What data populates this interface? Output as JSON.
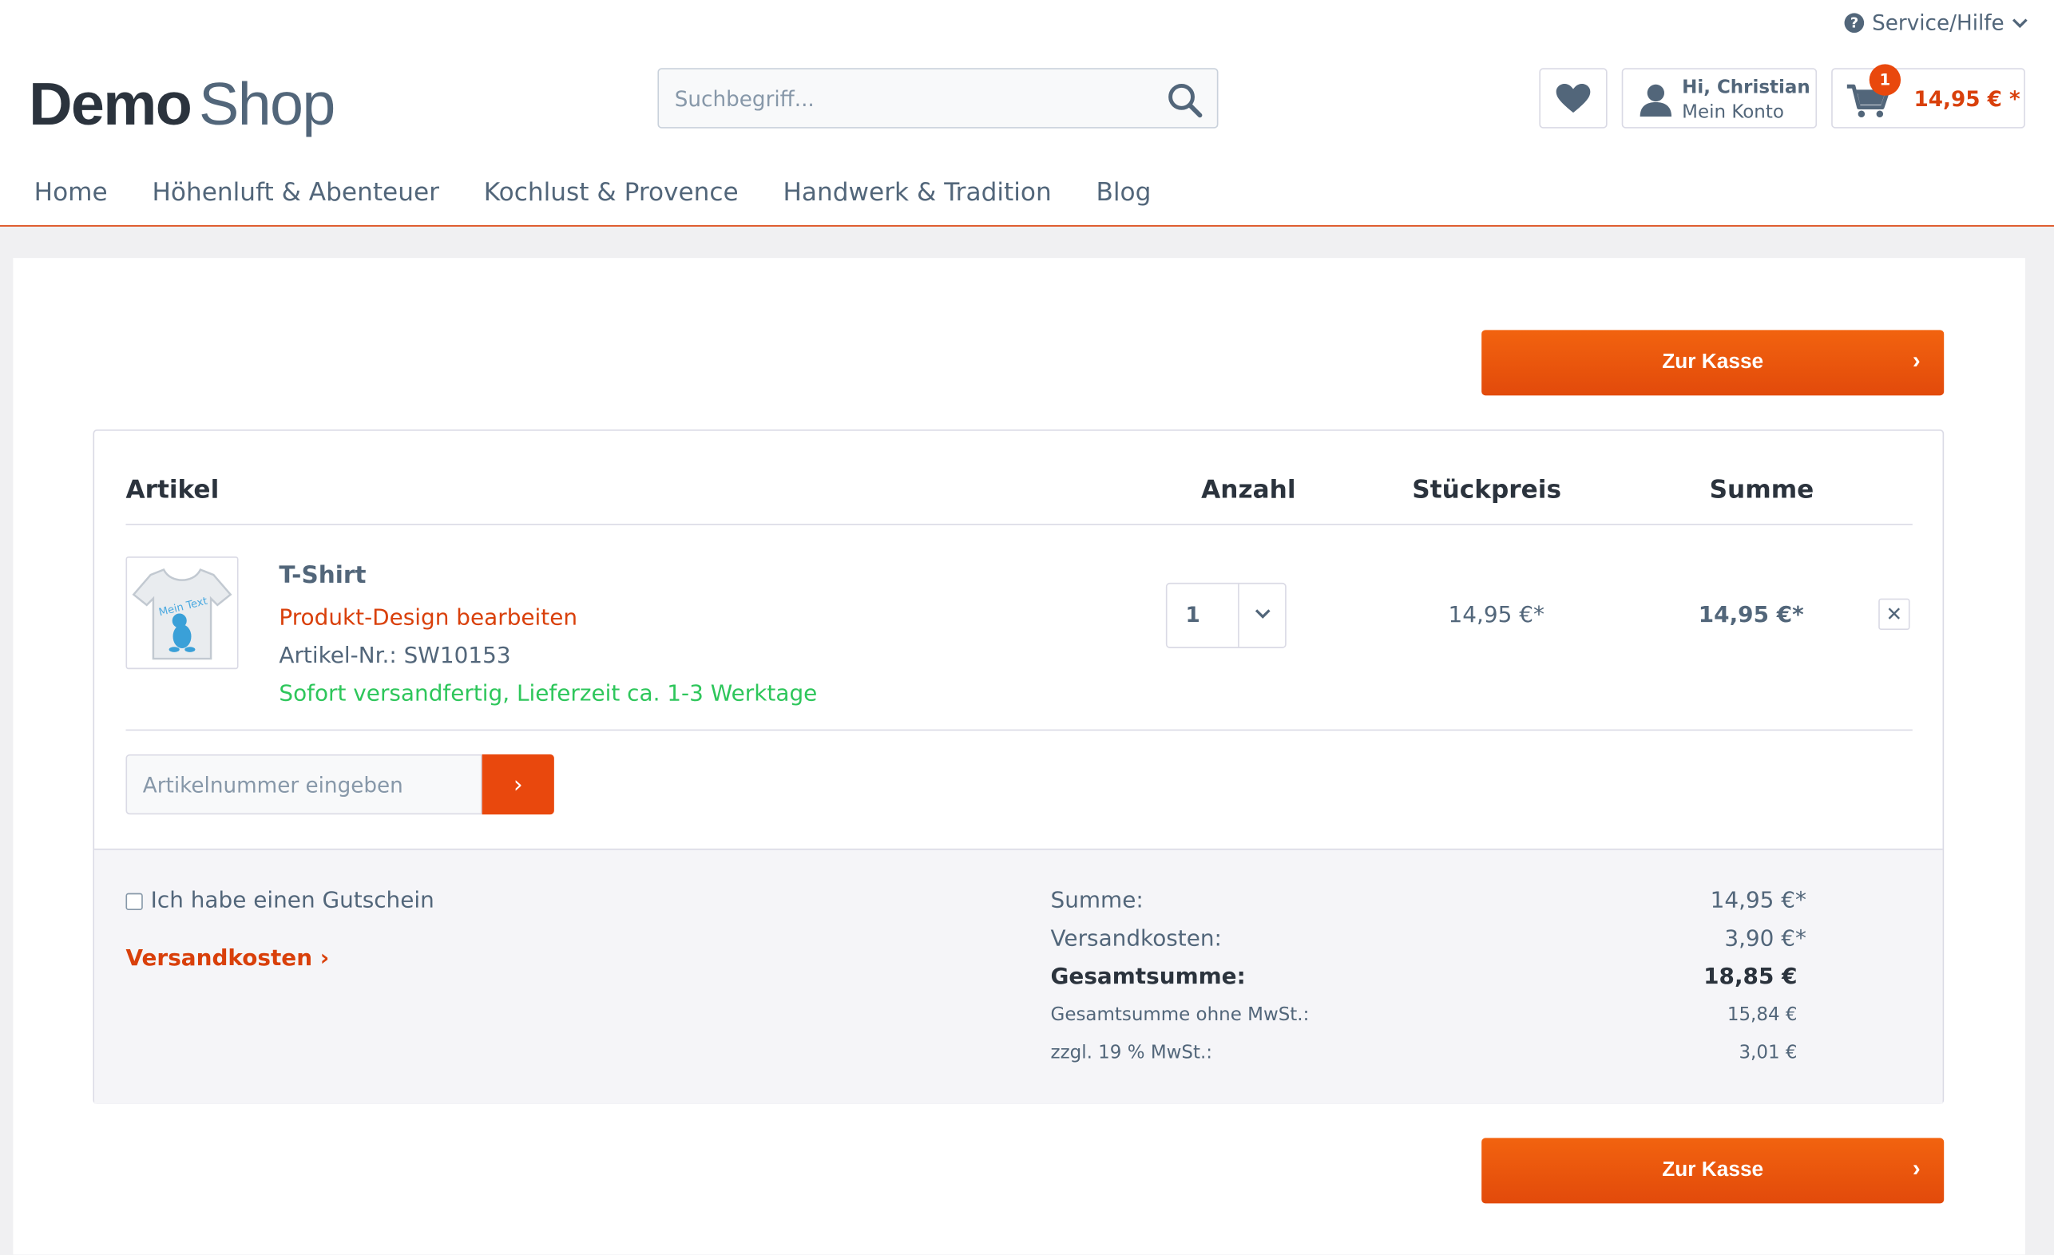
{
  "header": {
    "service_label": "Service/Hilfe",
    "logo_bold": "Demo",
    "logo_light": "Shop",
    "search_placeholder": "Suchbegriff...",
    "account_greeting": "Hi, Christian",
    "account_label": "Mein Konto",
    "cart_count": "1",
    "cart_total": "14,95 € *"
  },
  "nav": {
    "items": [
      "Home",
      "Höhenluft & Abenteuer",
      "Kochlust & Provence",
      "Handwerk & Tradition",
      "Blog"
    ]
  },
  "checkout_label": "Zur Kasse",
  "cart_table": {
    "headers": {
      "article": "Artikel",
      "quantity": "Anzahl",
      "unit_price": "Stückpreis",
      "total": "Summe"
    },
    "item": {
      "thumb_text": "Mein Text",
      "name": "T-Shirt",
      "design_link": "Produkt-Design bearbeiten",
      "article_no": "Artikel-Nr.: SW10153",
      "shipping": "Sofort versandfertig, Lieferzeit ca. 1-3 Werktage",
      "quantity": "1",
      "unit_price": "14,95 €*",
      "total": "14,95 €*",
      "remove": "✕"
    },
    "article_input_placeholder": "Artikelnummer eingeben"
  },
  "footer": {
    "voucher_label": "Ich habe einen Gutschein",
    "shipping_link": "Versandkosten",
    "totals": {
      "sum_label": "Summe:",
      "sum_value": "14,95 €*",
      "shipping_label": "Versandkosten:",
      "shipping_value": "3,90 €*",
      "grand_label": "Gesamtsumme:",
      "grand_value": "18,85 €",
      "net_label": "Gesamtsumme ohne MwSt.:",
      "net_value": "15,84 €",
      "vat_label": "zzgl. 19 % MwSt.:",
      "vat_value": "3,01 €"
    }
  },
  "colors": {
    "accent": "#e9480d",
    "text": "#52667a",
    "success": "#2ec65b"
  }
}
